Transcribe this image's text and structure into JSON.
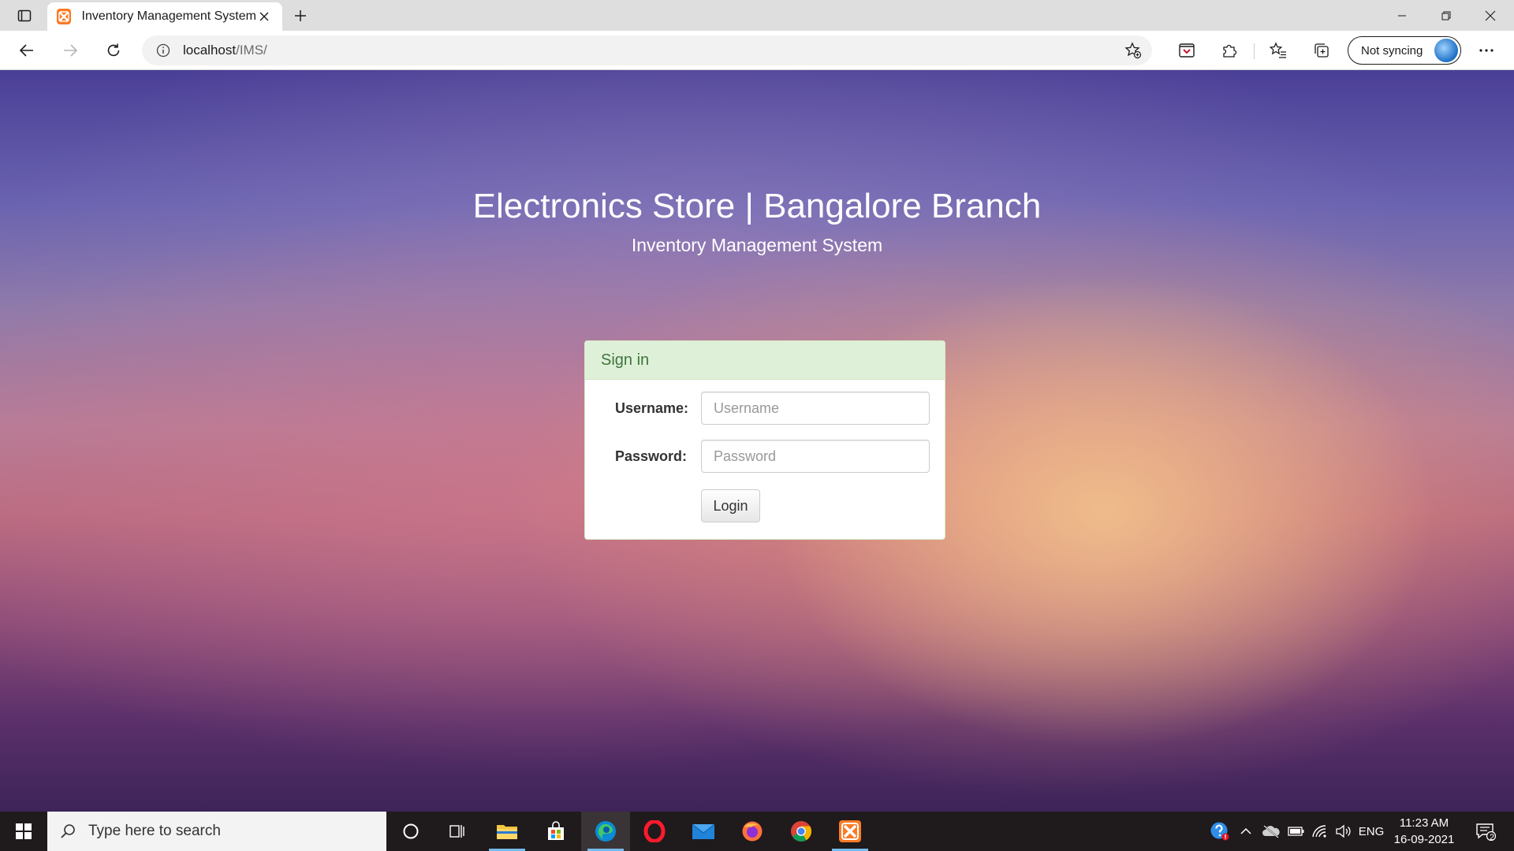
{
  "browser": {
    "tab_title": "Inventory Management System",
    "url_host": "localhost",
    "url_path": "/IMS/",
    "sync_label": "Not syncing",
    "accent": "#fb7a24"
  },
  "page": {
    "heading": "Electronics Store | Bangalore Branch",
    "subheading": "Inventory Management System",
    "login_panel": {
      "title": "Sign in",
      "username_label": "Username:",
      "username_placeholder": "Username",
      "password_label": "Password:",
      "password_placeholder": "Password",
      "login_button": "Login"
    },
    "colors": {
      "panel_header_bg": "#dff0d8",
      "panel_title": "#3c763d"
    }
  },
  "taskbar": {
    "search_placeholder": "Type here to search",
    "pinned": [
      "cortana-icon",
      "task-view-icon",
      "file-explorer-icon",
      "store-icon",
      "edge-icon",
      "opera-icon",
      "mail-icon",
      "firefox-icon",
      "chrome-icon",
      "xampp-icon"
    ],
    "language": "ENG",
    "time": "11:23 AM",
    "date": "16-09-2021",
    "notification_count": "2"
  }
}
